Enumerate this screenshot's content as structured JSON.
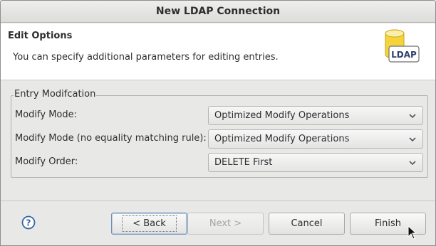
{
  "window": {
    "title": "New LDAP Connection"
  },
  "header": {
    "title": "Edit Options",
    "description": "You can specify additional parameters for editing entries.",
    "logo_text": "LDAP",
    "logo_icon": "ldap-database-icon"
  },
  "group": {
    "title": "Entry Modifcation",
    "rows": [
      {
        "label": "Modify Mode:",
        "value": "Optimized Modify Operations"
      },
      {
        "label": "Modify Mode (no equality matching rule):",
        "value": "Optimized Modify Operations"
      },
      {
        "label": "Modify Order:",
        "value": "DELETE First"
      }
    ]
  },
  "buttons": {
    "help_icon": "question-mark-icon",
    "back": "< Back",
    "next": "Next >",
    "cancel": "Cancel",
    "finish": "Finish"
  },
  "colors": {
    "accent": "#6f8fb8",
    "help_blue": "#3465a4",
    "logo_yellow": "#f5d33a"
  }
}
